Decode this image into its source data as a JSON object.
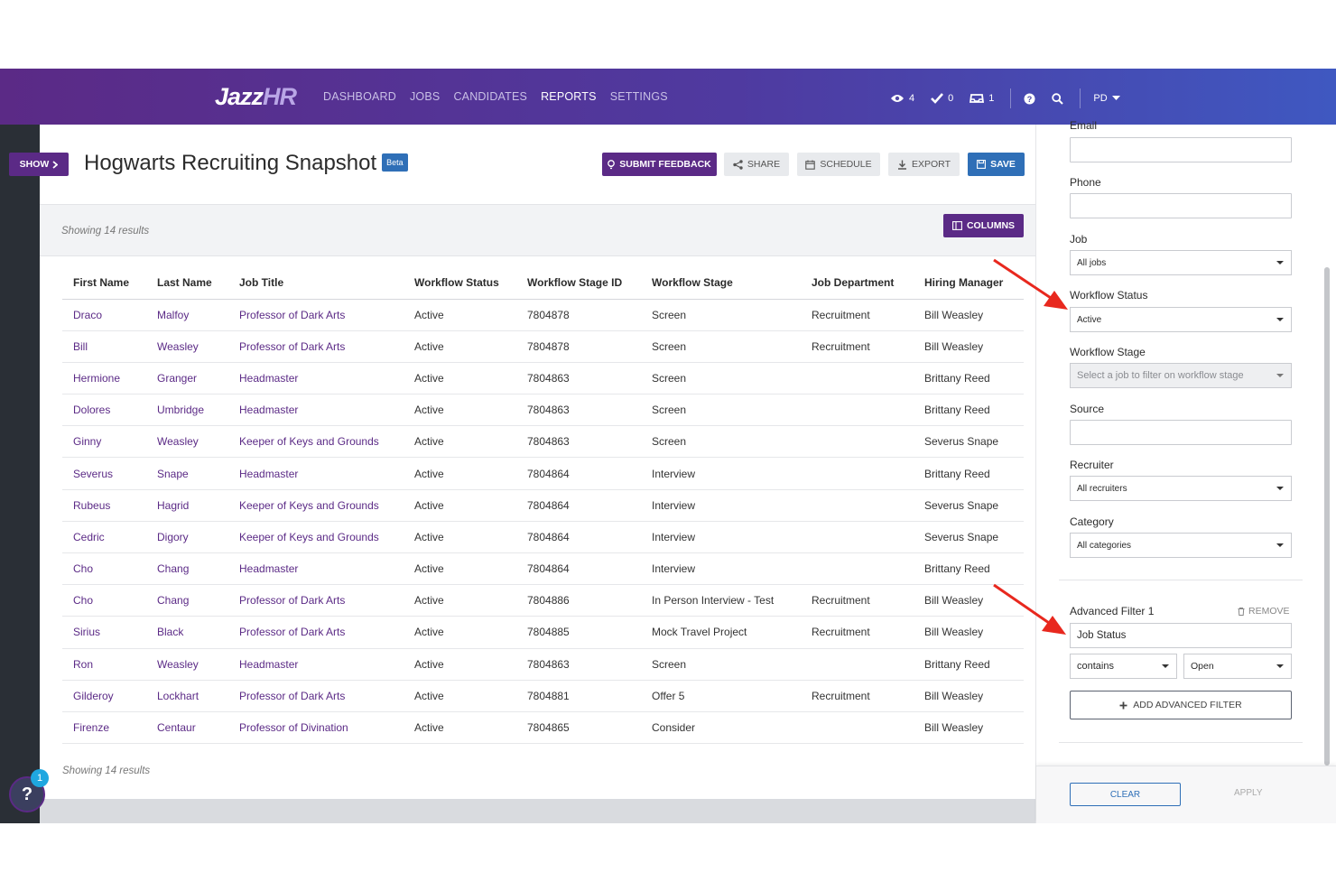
{
  "nav": {
    "logo_main": "Jazz",
    "logo_accent": "HR",
    "links": [
      "DASHBOARD",
      "JOBS",
      "CANDIDATES",
      "REPORTS",
      "SETTINGS"
    ],
    "active_link": "REPORTS",
    "views_count": "4",
    "tasks_count": "0",
    "inbox_count": "1",
    "user_initials": "PD"
  },
  "header": {
    "show_label": "SHOW",
    "title": "Hogwarts Recruiting Snapshot",
    "beta": "Beta",
    "submit_feedback": "SUBMIT FEEDBACK",
    "share": "SHARE",
    "schedule": "SCHEDULE",
    "export": "EXPORT",
    "save": "SAVE"
  },
  "results": {
    "showing_text": "Showing 14 results",
    "columns_label": "COLUMNS"
  },
  "table": {
    "headers": [
      "First Name",
      "Last Name",
      "Job Title",
      "Workflow Status",
      "Workflow Stage ID",
      "Workflow Stage",
      "Job Department",
      "Hiring Manager"
    ],
    "rows": [
      [
        "Draco",
        "Malfoy",
        "Professor of Dark Arts",
        "Active",
        "7804878",
        "Screen",
        "Recruitment",
        "Bill Weasley"
      ],
      [
        "Bill",
        "Weasley",
        "Professor of Dark Arts",
        "Active",
        "7804878",
        "Screen",
        "Recruitment",
        "Bill Weasley"
      ],
      [
        "Hermione",
        "Granger",
        "Headmaster",
        "Active",
        "7804863",
        "Screen",
        "",
        "Brittany Reed"
      ],
      [
        "Dolores",
        "Umbridge",
        "Headmaster",
        "Active",
        "7804863",
        "Screen",
        "",
        "Brittany Reed"
      ],
      [
        "Ginny",
        "Weasley",
        "Keeper of Keys and Grounds",
        "Active",
        "7804863",
        "Screen",
        "",
        "Severus Snape"
      ],
      [
        "Severus",
        "Snape",
        "Headmaster",
        "Active",
        "7804864",
        "Interview",
        "",
        "Brittany Reed"
      ],
      [
        "Rubeus",
        "Hagrid",
        "Keeper of Keys and Grounds",
        "Active",
        "7804864",
        "Interview",
        "",
        "Severus Snape"
      ],
      [
        "Cedric",
        "Digory",
        "Keeper of Keys and Grounds",
        "Active",
        "7804864",
        "Interview",
        "",
        "Severus Snape"
      ],
      [
        "Cho",
        "Chang",
        "Headmaster",
        "Active",
        "7804864",
        "Interview",
        "",
        "Brittany Reed"
      ],
      [
        "Cho",
        "Chang",
        "Professor of Dark Arts",
        "Active",
        "7804886",
        "In Person Interview - Test",
        "Recruitment",
        "Bill Weasley"
      ],
      [
        "Sirius",
        "Black",
        "Professor of Dark Arts",
        "Active",
        "7804885",
        "Mock Travel Project",
        "Recruitment",
        "Bill Weasley"
      ],
      [
        "Ron",
        "Weasley",
        "Headmaster",
        "Active",
        "7804863",
        "Screen",
        "",
        "Brittany Reed"
      ],
      [
        "Gilderoy",
        "Lockhart",
        "Professor of Dark Arts",
        "Active",
        "7804881",
        "Offer 5",
        "Recruitment",
        "Bill Weasley"
      ],
      [
        "Firenze",
        "Centaur",
        "Professor of Divination",
        "Active",
        "7804865",
        "Consider",
        "",
        "Bill Weasley"
      ]
    ]
  },
  "help": {
    "badge": "1",
    "glyph": "?"
  },
  "filters": {
    "email_label": "Email",
    "phone_label": "Phone",
    "job_label": "Job",
    "job_value": "All jobs",
    "workflow_status_label": "Workflow Status",
    "workflow_status_value": "Active",
    "workflow_stage_label": "Workflow Stage",
    "workflow_stage_placeholder": "Select a job to filter on workflow stage",
    "source_label": "Source",
    "recruiter_label": "Recruiter",
    "recruiter_value": "All recruiters",
    "category_label": "Category",
    "category_value": "All categories",
    "advanced_label": "Advanced Filter 1",
    "remove_label": "REMOVE",
    "advanced_field": "Job Status",
    "operator_value": "contains",
    "operand_value": "Open",
    "add_advanced": "ADD ADVANCED FILTER",
    "clear": "CLEAR",
    "apply": "APPLY"
  },
  "colors": {
    "brand_purple": "#5b2a86",
    "brand_blue": "#2f6fb7",
    "annotation_arrow": "#e8281e"
  }
}
